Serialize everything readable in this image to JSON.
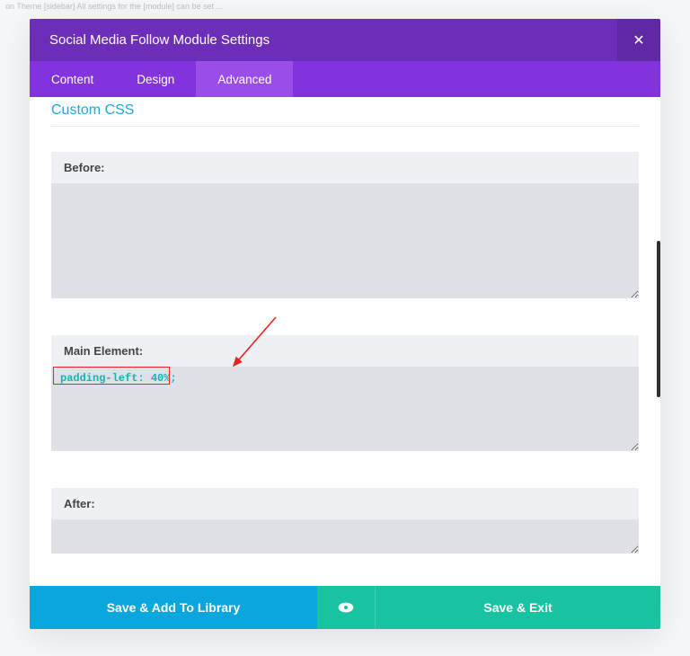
{
  "background_text_1": "on Theme [sidebar] All settings for the [module] can be set ...",
  "background_text_2": "",
  "modal": {
    "title": "Social Media Follow Module Settings"
  },
  "tabs": {
    "content": "Content",
    "design": "Design",
    "advanced": "Advanced"
  },
  "section": {
    "title": "Custom CSS"
  },
  "fields": {
    "before": {
      "label": "Before:",
      "value": ""
    },
    "main": {
      "label": "Main Element:",
      "value": "padding-left: 40%;"
    },
    "after": {
      "label": "After:",
      "value": ""
    }
  },
  "footer": {
    "save_library": "Save & Add To Library",
    "save_exit": "Save & Exit"
  }
}
